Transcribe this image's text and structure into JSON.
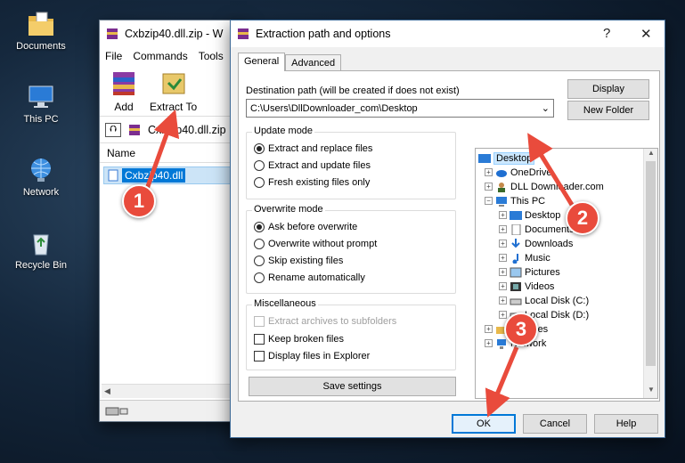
{
  "desktop": {
    "icons": [
      {
        "label": "Documents",
        "icon": "folder-documents-icon"
      },
      {
        "label": "This PC",
        "icon": "computer-icon"
      },
      {
        "label": "Network",
        "icon": "network-globe-icon"
      },
      {
        "label": "Recycle Bin",
        "icon": "recycle-bin-icon"
      }
    ]
  },
  "winrar": {
    "title": "Cxbzip40.dll.zip - W",
    "menu": [
      "File",
      "Commands",
      "Tools"
    ],
    "toolbar": {
      "add": "Add",
      "extract_to": "Extract To"
    },
    "address": "Cxbzip40.dll.zip",
    "column_name": "Name",
    "file": "Cxbzip40.dll"
  },
  "dialog": {
    "title": "Extraction path and options",
    "help_glyph": "?",
    "close_glyph": "✕",
    "tabs": [
      "General",
      "Advanced"
    ],
    "destination_label": "Destination path (will be created if does not exist)",
    "destination_value": "C:\\Users\\DllDownloader_com\\Desktop",
    "display_button": "Display",
    "new_folder_button": "New Folder",
    "update_mode": {
      "title": "Update mode",
      "options": [
        "Extract and replace files",
        "Extract and update files",
        "Fresh existing files only"
      ],
      "selected": 0
    },
    "overwrite_mode": {
      "title": "Overwrite mode",
      "options": [
        "Ask before overwrite",
        "Overwrite without prompt",
        "Skip existing files",
        "Rename automatically"
      ],
      "selected": 0
    },
    "misc": {
      "title": "Miscellaneous",
      "options": [
        "Extract archives to subfolders",
        "Keep broken files",
        "Display files in Explorer"
      ]
    },
    "save_settings": "Save settings",
    "tree": {
      "desktop": "Desktop",
      "onedrive": "OneDrive",
      "user": "DLL Downloader.com",
      "this_pc": "This PC",
      "children": [
        "Desktop",
        "Documents",
        "Downloads",
        "Music",
        "Pictures",
        "Videos",
        "Local Disk (C:)",
        "Local Disk (D:)"
      ],
      "libraries": "Libraries",
      "network": "Network"
    },
    "ok": "OK",
    "cancel": "Cancel",
    "help": "Help"
  },
  "callouts": [
    "1",
    "2",
    "3"
  ],
  "colors": {
    "callout": "#e94b3c",
    "selection": "#0078d7"
  }
}
